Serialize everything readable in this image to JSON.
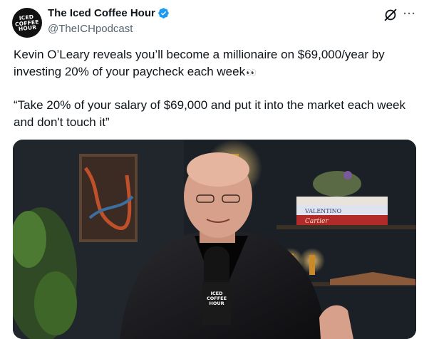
{
  "author": {
    "display_name": "The Iced Coffee Hour",
    "handle": "@TheICHpodcast",
    "avatar_text": "ICED\nCOFFEE\nHOUR",
    "verified": true
  },
  "tweet": {
    "line1": "Kevin O’Leary reveals you’ll become a millionaire on $69,000/year by investing 20% of your paycheck each week",
    "emoji": "👀",
    "line2": "“Take 20% of your salary of $69,000 and put it into the market each week and don't touch it”"
  },
  "media": {
    "mic_logo_text": "ICED\nCOFFEE\nHOUR",
    "book_spines": [
      "Cartier",
      "VALENTINO"
    ]
  },
  "icons": {
    "grok": "grok-icon",
    "more": "more-icon",
    "verified": "verified-badge-icon"
  },
  "colors": {
    "text": "#0f1419",
    "secondary": "#536471",
    "verified_blue": "#1d9bf0"
  }
}
